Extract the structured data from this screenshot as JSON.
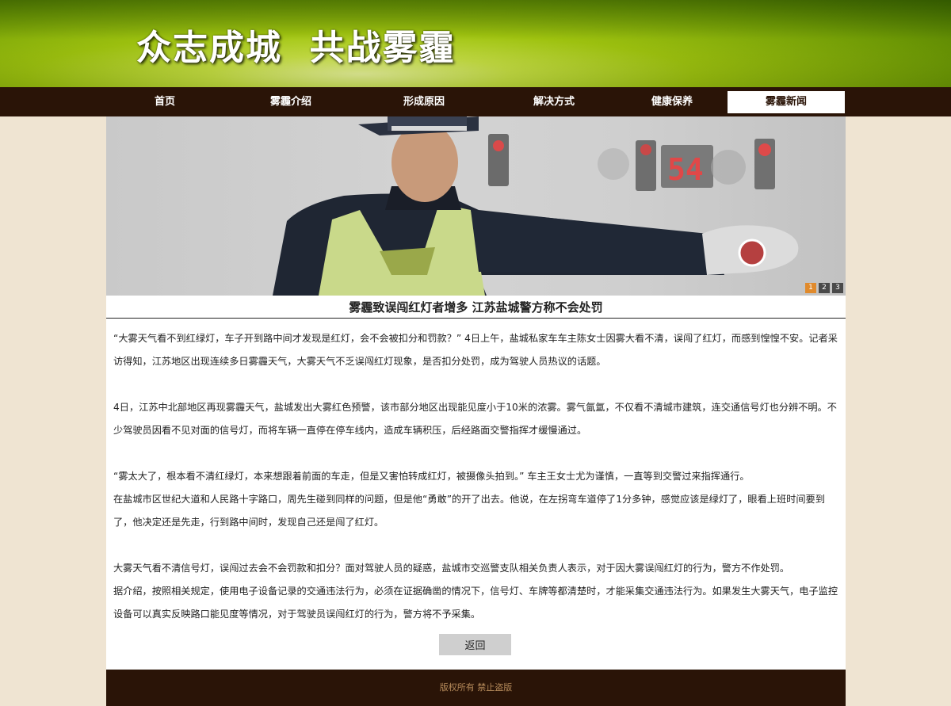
{
  "site": {
    "title": "众志成城  共战雾霾"
  },
  "nav": {
    "items": [
      {
        "label": "首页"
      },
      {
        "label": "雾霾介绍"
      },
      {
        "label": "形成原因"
      },
      {
        "label": "解决方式"
      },
      {
        "label": "健康保养"
      },
      {
        "label": "雾霾新闻",
        "active": true
      }
    ]
  },
  "hero": {
    "signal_number": "54",
    "slides": [
      "1",
      "2",
      "3"
    ],
    "active_slide": 0
  },
  "article": {
    "title": "雾霾致误闯红灯者增多 江苏盐城警方称不会处罚",
    "paragraphs": [
      "“大雾天气看不到红绿灯，车子开到路中间才发现是红灯，会不会被扣分和罚款？” 4日上午，盐城私家车车主陈女士因雾大看不清，误闯了红灯，而感到惶惶不安。记者采访得知，江苏地区出现连续多日雾霾天气，大雾天气不乏误闯红灯现象，是否扣分处罚，成为驾驶人员热议的话题。",
      "",
      "4日，江苏中北部地区再现雾霾天气，盐城发出大雾红色预警，该市部分地区出现能见度小于10米的浓雾。雾气氤氲，不仅看不清城市建筑，连交通信号灯也分辨不明。不少驾驶员因看不见对面的信号灯，而将车辆一直停在停车线内，造成车辆积压，后经路面交警指挥才缓慢通过。",
      "",
      "“雾太大了，根本看不清红绿灯，本来想跟着前面的车走，但是又害怕转成红灯，被摄像头拍到。” 车主王女士尤为谨慎，一直等到交警过来指挥通行。",
      "在盐城市区世纪大道和人民路十字路口，周先生碰到同样的问题，但是他“勇敢”的开了出去。他说，在左拐弯车道停了1分多钟，感觉应该是绿灯了，眼看上班时间要到了，他决定还是先走，行到路中间时，发现自己还是闯了红灯。",
      "",
      "大雾天气看不清信号灯，误闯过去会不会罚款和扣分？面对驾驶人员的疑惑，盐城市交巡警支队相关负责人表示，对于因大雾误闯红灯的行为，警方不作处罚。",
      "据介绍，按照相关规定，使用电子设备记录的交通违法行为，必须在证据确凿的情况下，信号灯、车牌等都清楚时，才能采集交通违法行为。如果发生大雾天气，电子监控设备可以真实反映路口能见度等情况，对于驾驶员误闯红灯的行为，警方将不予采集。"
    ],
    "back_label": "返回"
  },
  "footer": {
    "text": "版权所有 禁止盗版"
  },
  "colors": {
    "nav_bg": "#2a1407",
    "page_bg": "#efe4d2",
    "accent": "#e08a2c"
  }
}
